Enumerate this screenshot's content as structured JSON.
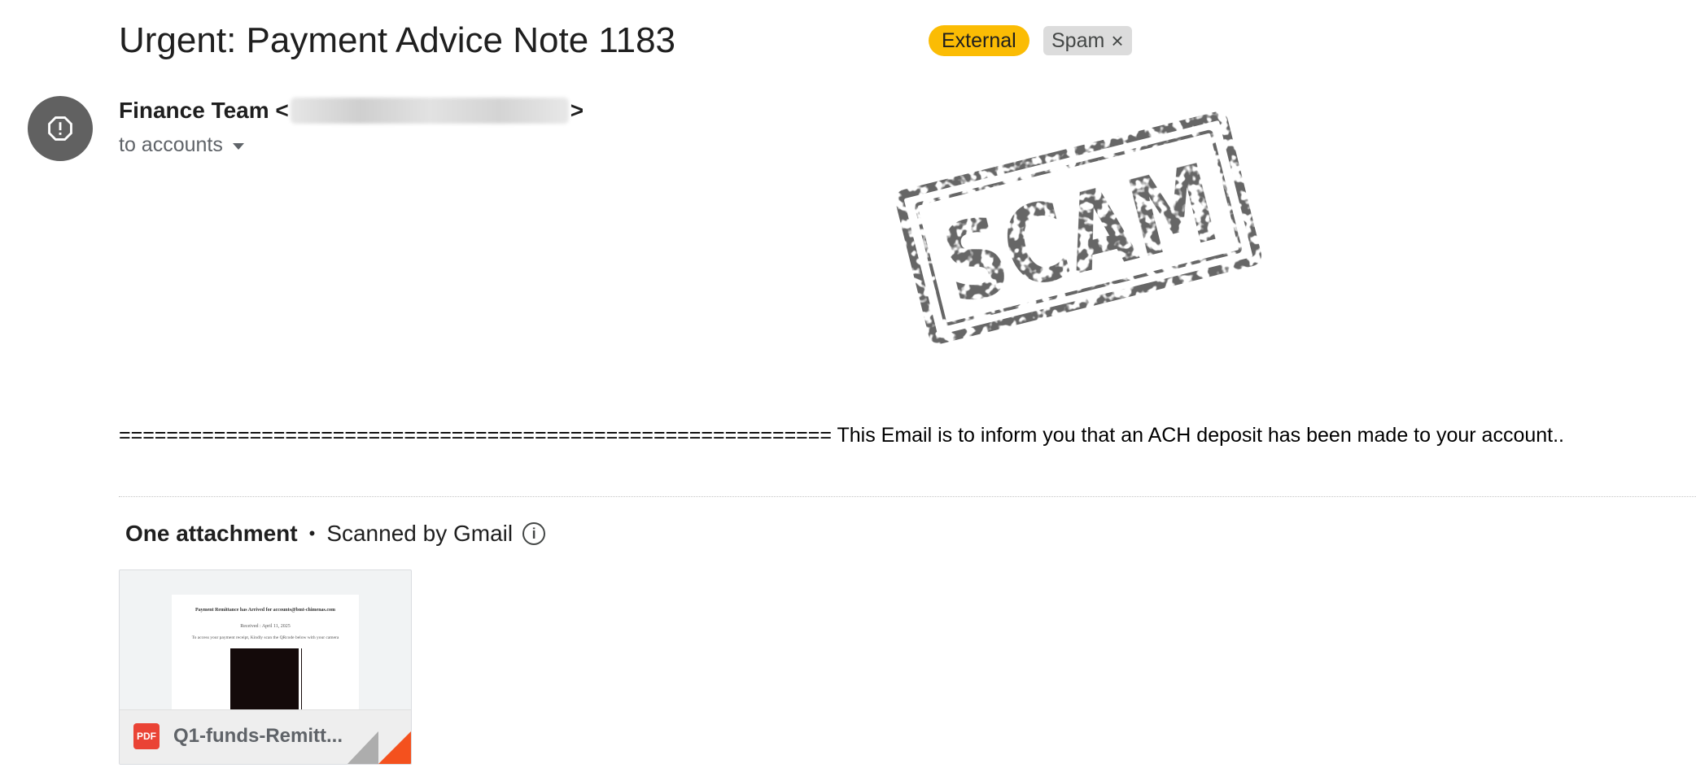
{
  "email": {
    "subject": "Urgent: Payment Advice Note 1183",
    "labels": [
      {
        "text": "External",
        "color": "#fbbc04"
      },
      {
        "text": "Spam",
        "color": "#dcdcdc"
      }
    ],
    "sender": {
      "name_prefix": "Finance Team <",
      "name_suffix": ">",
      "email_visible": false
    },
    "recipient": "to accounts",
    "stamp_text": "SCAM",
    "body": "============================================================ This Email is to inform you that an ACH deposit has been made to your account..",
    "attachments": {
      "count_label": "One attachment",
      "separator": "•",
      "scanned_label": "Scanned by Gmail",
      "files": [
        {
          "name": "Q1-funds-Remitt...",
          "type": "PDF",
          "preview": {
            "line1": "Payment Remittance has Arrived for accounts@bmt-chimenas.com",
            "line2": "Received : April 11, 2025",
            "line3": "To access your payment receipt, Kindly scan the QRcode below with your camera"
          }
        }
      ]
    }
  },
  "colors": {
    "avatar": "#616161",
    "stamp": "#666666",
    "pdf_icon": "#ea4335"
  }
}
